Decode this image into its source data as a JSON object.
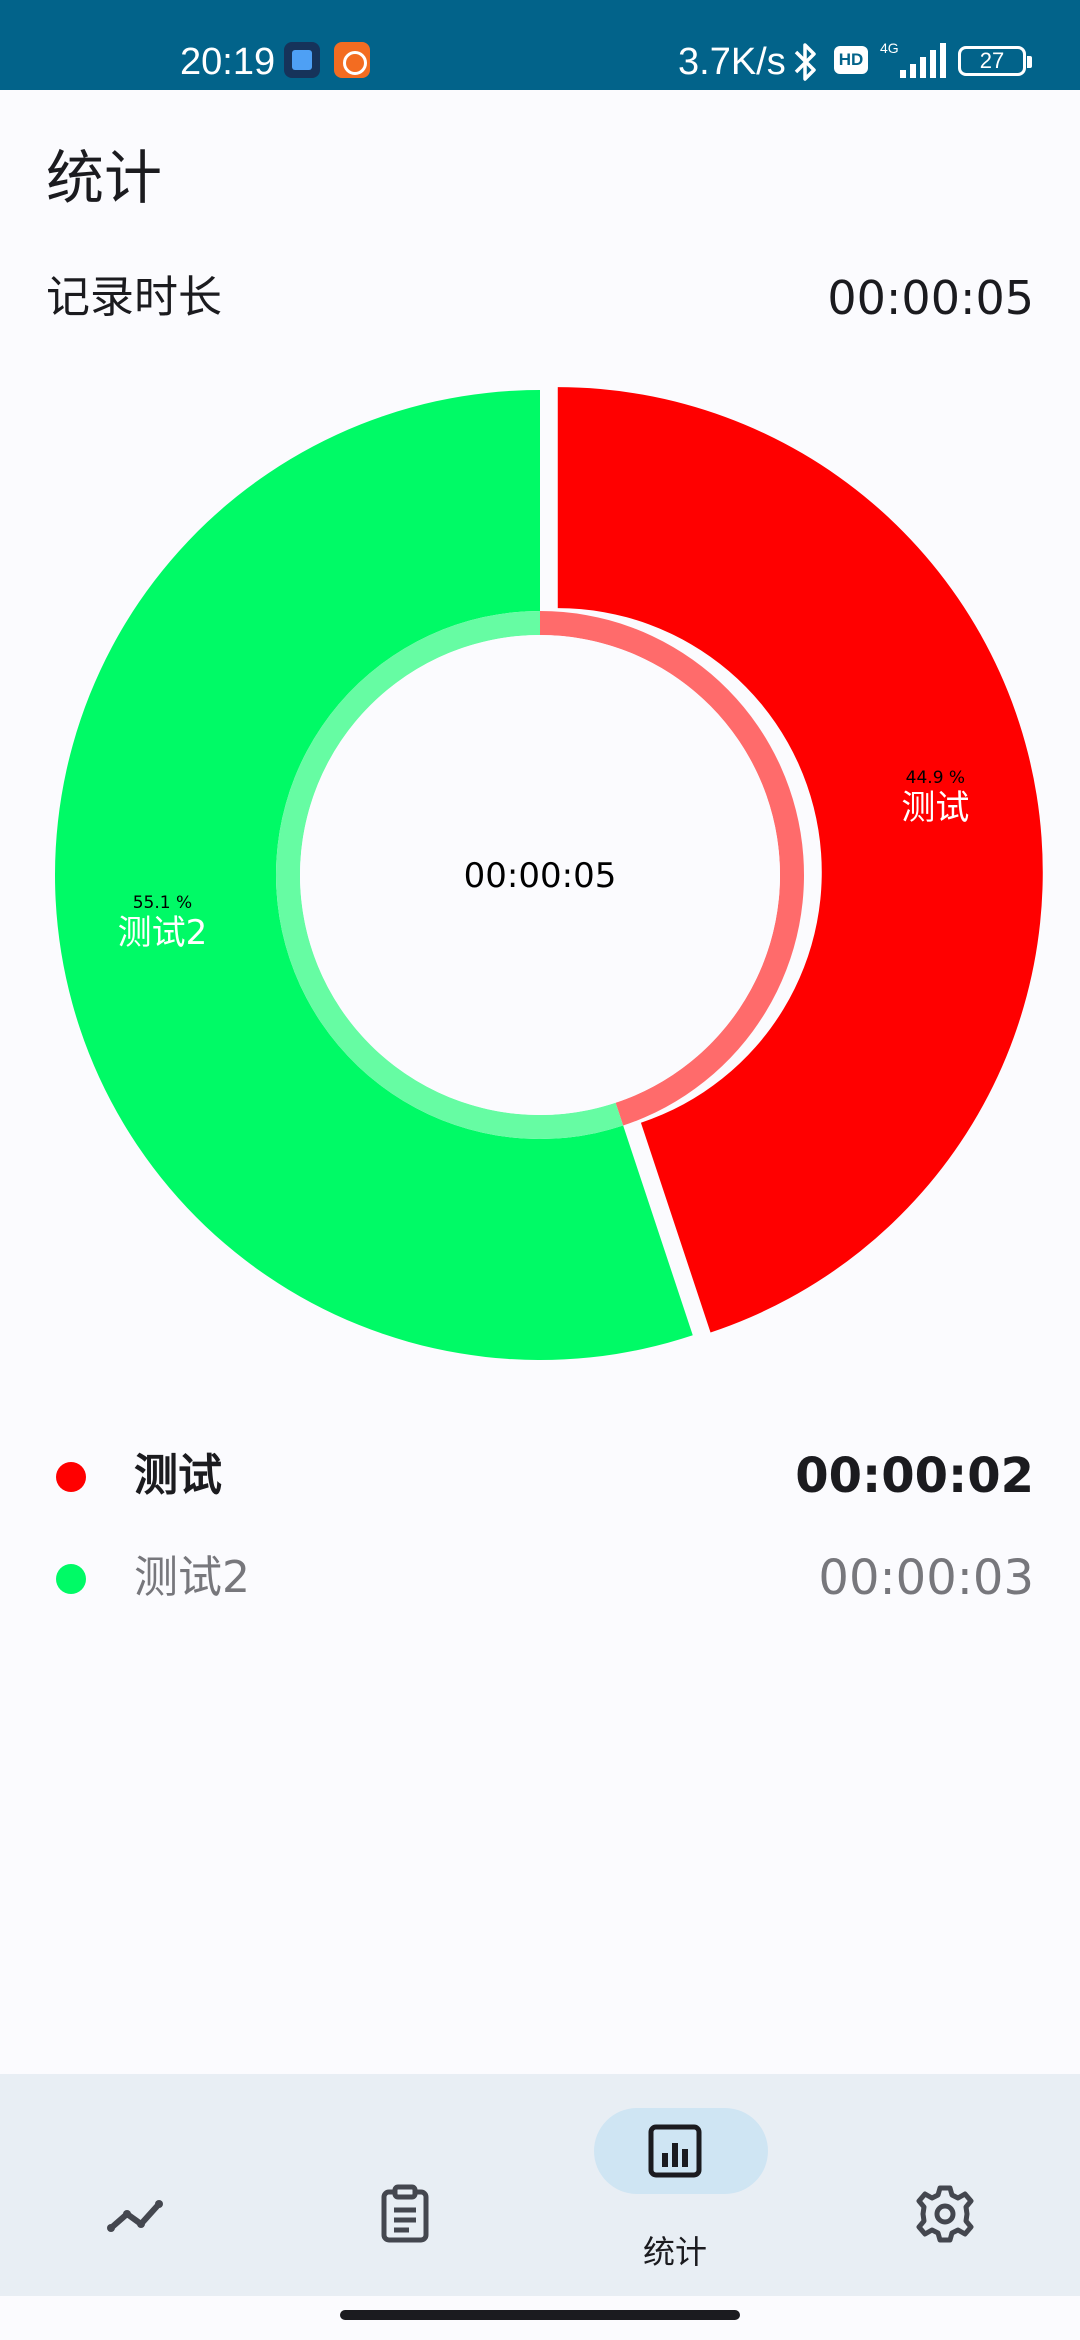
{
  "status_bar": {
    "time": "20:19",
    "network_speed": "3.7K/s",
    "hd_badge": "HD",
    "network_type": "4G",
    "battery": "27",
    "icons": [
      "app-icon",
      "mi-icon",
      "bluetooth-icon",
      "hd-icon",
      "signal-icon",
      "battery-icon"
    ]
  },
  "page": {
    "title": "统计",
    "record_label": "记录时长",
    "record_value": "00:00:05"
  },
  "chart_data": {
    "type": "pie",
    "variant": "donut",
    "center_text": "00:00:05",
    "slices": [
      {
        "name": "测试",
        "value": 44.9,
        "percent_label": "44.9 %",
        "color": "#ff0000",
        "inner_color": "#ff6b6b"
      },
      {
        "name": "测试2",
        "value": 55.1,
        "percent_label": "55.1 %",
        "color": "#00fa66",
        "inner_color": "#66fca3"
      }
    ]
  },
  "legend": [
    {
      "name": "测试",
      "duration": "00:00:02",
      "color": "#ff0000",
      "active": true
    },
    {
      "name": "测试2",
      "duration": "00:00:03",
      "color": "#00fa66",
      "active": false
    }
  ],
  "nav": {
    "items": [
      {
        "id": "trend",
        "icon": "trend-icon",
        "label": ""
      },
      {
        "id": "records",
        "icon": "clipboard-icon",
        "label": ""
      },
      {
        "id": "stats",
        "icon": "bar-chart-icon",
        "label": "统计",
        "selected": true
      },
      {
        "id": "settings",
        "icon": "gear-icon",
        "label": ""
      }
    ]
  },
  "colors": {
    "status_bar": "#02638a",
    "background": "#fbfbfe",
    "nav_background": "#e8eef4",
    "nav_selected_pill": "#cfe5f3"
  }
}
